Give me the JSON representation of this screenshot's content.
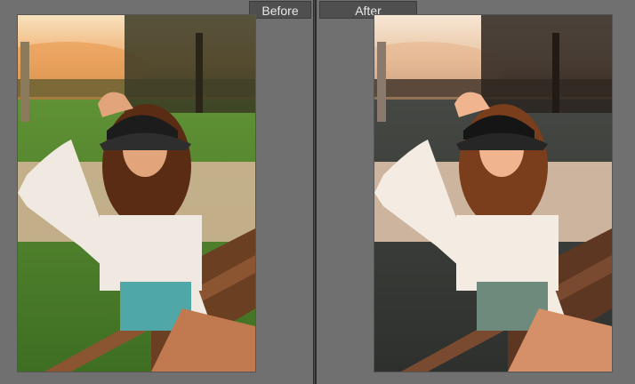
{
  "comparison": {
    "before_label": "Before",
    "after_label": "After"
  },
  "colors": {
    "before_sky": "#f2d6a5",
    "before_grass": "#4f8a2e",
    "after_sky": "#f4dcc0",
    "after_grass": "#3d3f3c"
  }
}
